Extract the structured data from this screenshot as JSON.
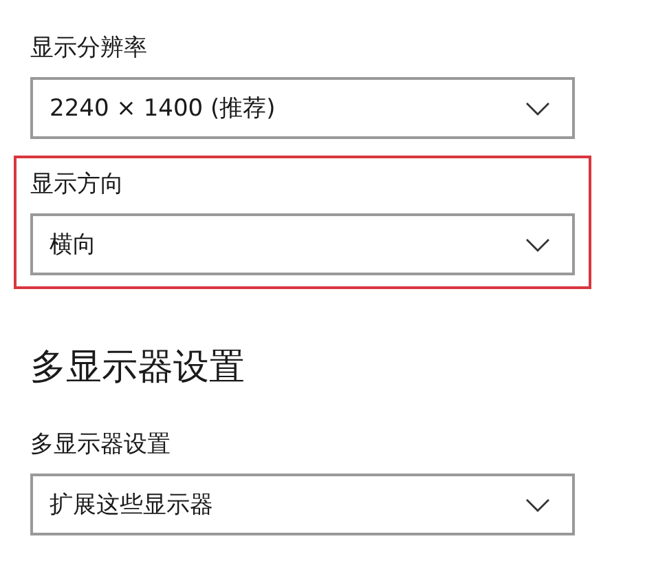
{
  "settings": [
    {
      "kind": "dropdown",
      "label": "显示分辨率",
      "value": "2240 × 1400 (推荐)",
      "highlighted": false
    },
    {
      "kind": "dropdown",
      "label": "显示方向",
      "value": "横向",
      "highlighted": true
    },
    {
      "kind": "heading",
      "label": "多显示器设置"
    },
    {
      "kind": "dropdown",
      "label": "多显示器设置",
      "value": "扩展这些显示器",
      "highlighted": false
    }
  ]
}
